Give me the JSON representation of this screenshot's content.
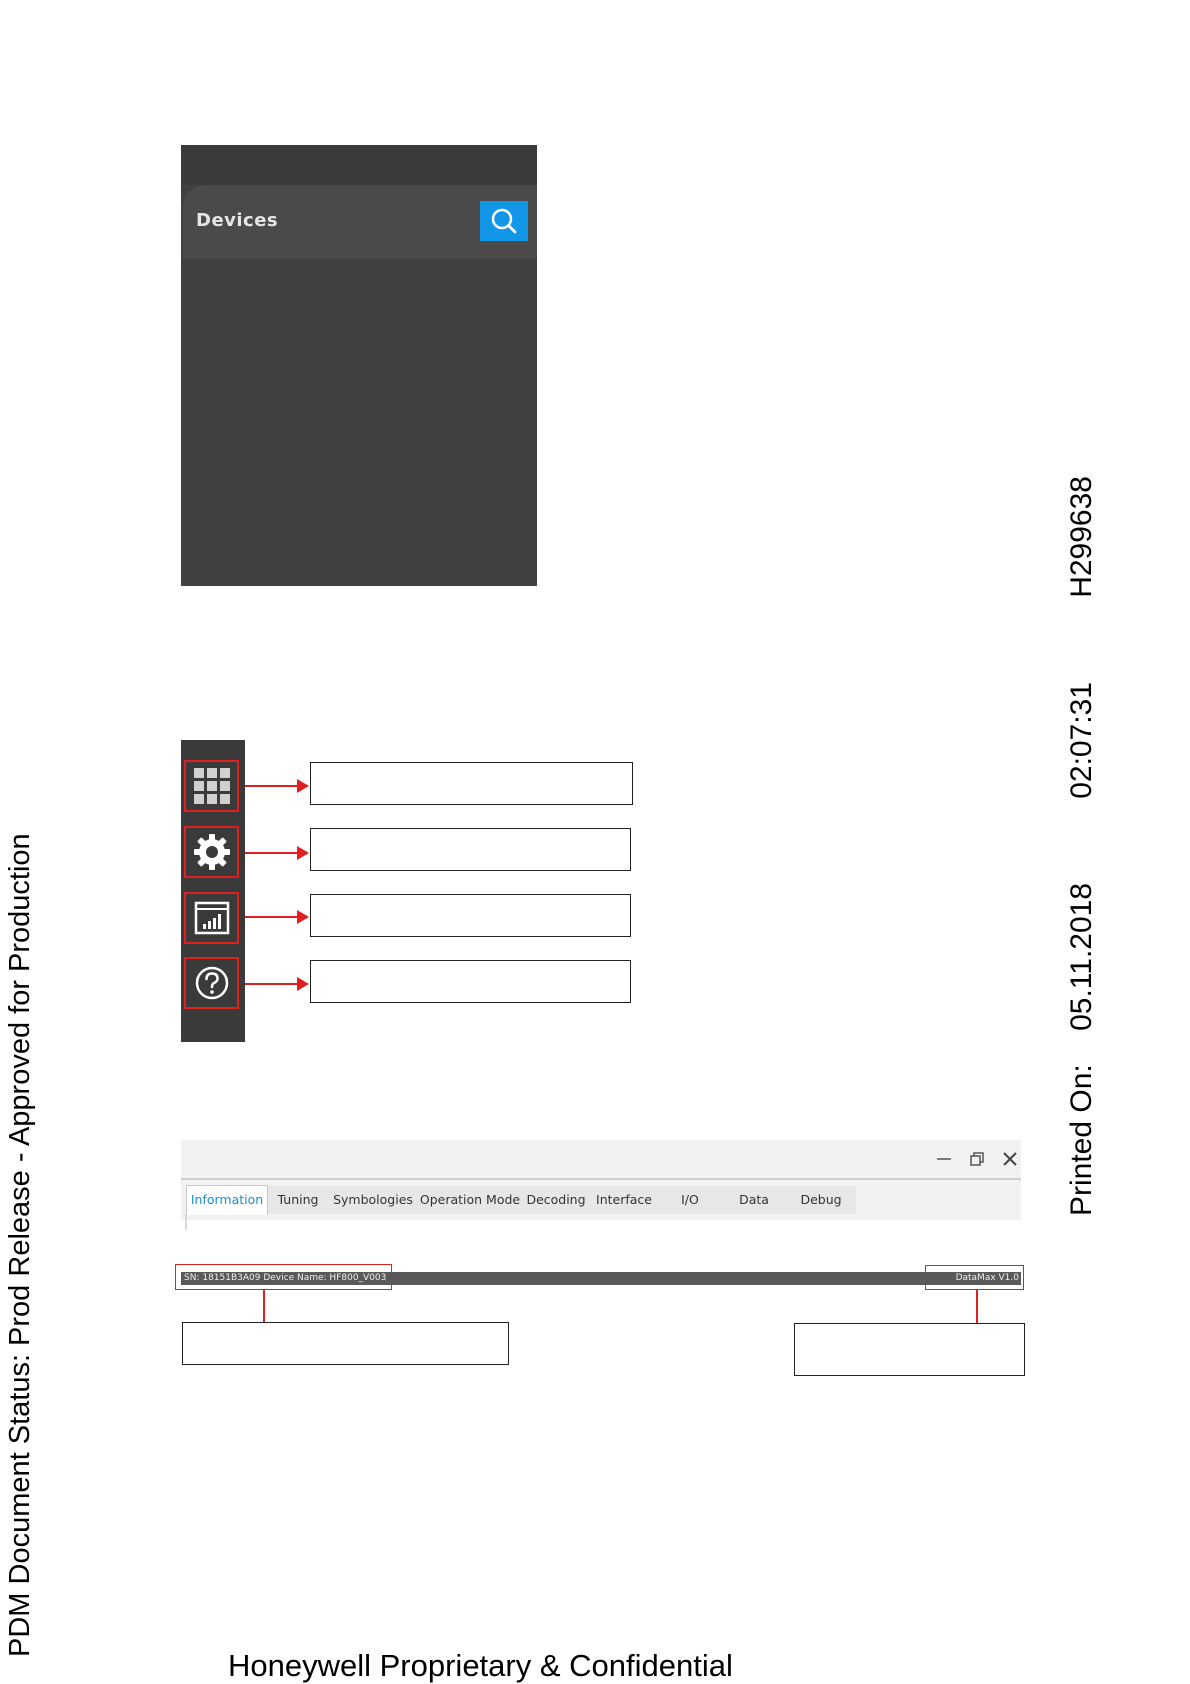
{
  "devices_panel": {
    "title": "Devices",
    "search_icon": "search-icon",
    "accent": "#1296e8"
  },
  "side_nav": {
    "items": [
      {
        "icon": "grid-icon"
      },
      {
        "icon": "gear-icon"
      },
      {
        "icon": "report-icon"
      },
      {
        "icon": "help-icon"
      }
    ]
  },
  "window": {
    "controls": [
      "minimize-icon",
      "restore-icon",
      "close-icon"
    ],
    "tabs": [
      {
        "label": "Information"
      },
      {
        "label": "Tuning"
      },
      {
        "label": "Symbologies"
      },
      {
        "label": "Operation Mode"
      },
      {
        "label": "Decoding"
      },
      {
        "label": "Interface"
      },
      {
        "label": "I/O"
      },
      {
        "label": "Data"
      },
      {
        "label": "Debug"
      }
    ],
    "active_tab": "Information",
    "status_left": "SN: 18151B3A09 Device Name: HF800_V003",
    "status_right": "DataMax V1.0"
  },
  "margin": {
    "pdm_status": "PDM Document Status: Prod Release - Approved for Production",
    "printed_label": "Printed On:",
    "printed_date": "05.11.2018",
    "printed_time": "02:07:31",
    "doc_id": "H299638"
  },
  "footer": {
    "text": "Honeywell Proprietary & Confidential"
  }
}
